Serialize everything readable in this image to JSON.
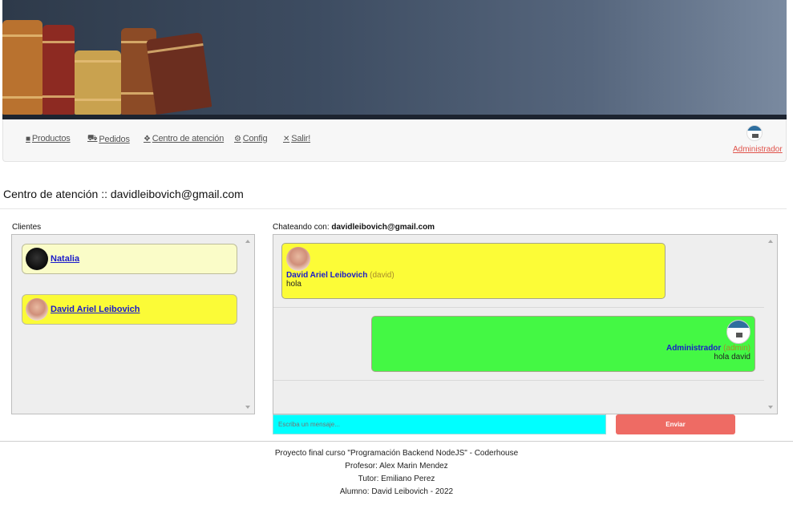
{
  "nav": {
    "items": [
      {
        "label": "Productos",
        "icon": "book-icon"
      },
      {
        "label": "Pedidos",
        "icon": "truck-icon"
      },
      {
        "label": "Centro de atención",
        "icon": "support-icon"
      },
      {
        "label": "Config",
        "icon": "gear-icon"
      },
      {
        "label": "Salir!",
        "icon": "close-icon"
      }
    ],
    "user_label": "Administrador"
  },
  "page": {
    "title": "Centro de atención :: davidleibovich@gmail.com"
  },
  "clients": {
    "label": "Clientes",
    "items": [
      {
        "name": "Natalia",
        "color": "#fafcc8"
      },
      {
        "name": "David Ariel Leibovich",
        "color": "#fbfb37"
      }
    ]
  },
  "chat": {
    "label_prefix": "Chateando con: ",
    "with": "davidleibovich@gmail.com",
    "messages": [
      {
        "author": "David Ariel Leibovich",
        "role": "(david)",
        "text": "hola",
        "side": "left",
        "color": "#fcfc37"
      },
      {
        "author": "Administrador",
        "role": "(admin)",
        "text": "hola david",
        "side": "right",
        "color": "#44f844"
      }
    ],
    "input_placeholder": "Escriba un mensaje...",
    "send_label": "Enviar"
  },
  "footer": {
    "lines": [
      "Proyecto final curso \"Programación Backend NodeJS\" - Coderhouse",
      "Profesor: Alex Marin Mendez",
      "Tutor: Emiliano Perez",
      "Alumno: David Leibovich - 2022"
    ]
  }
}
